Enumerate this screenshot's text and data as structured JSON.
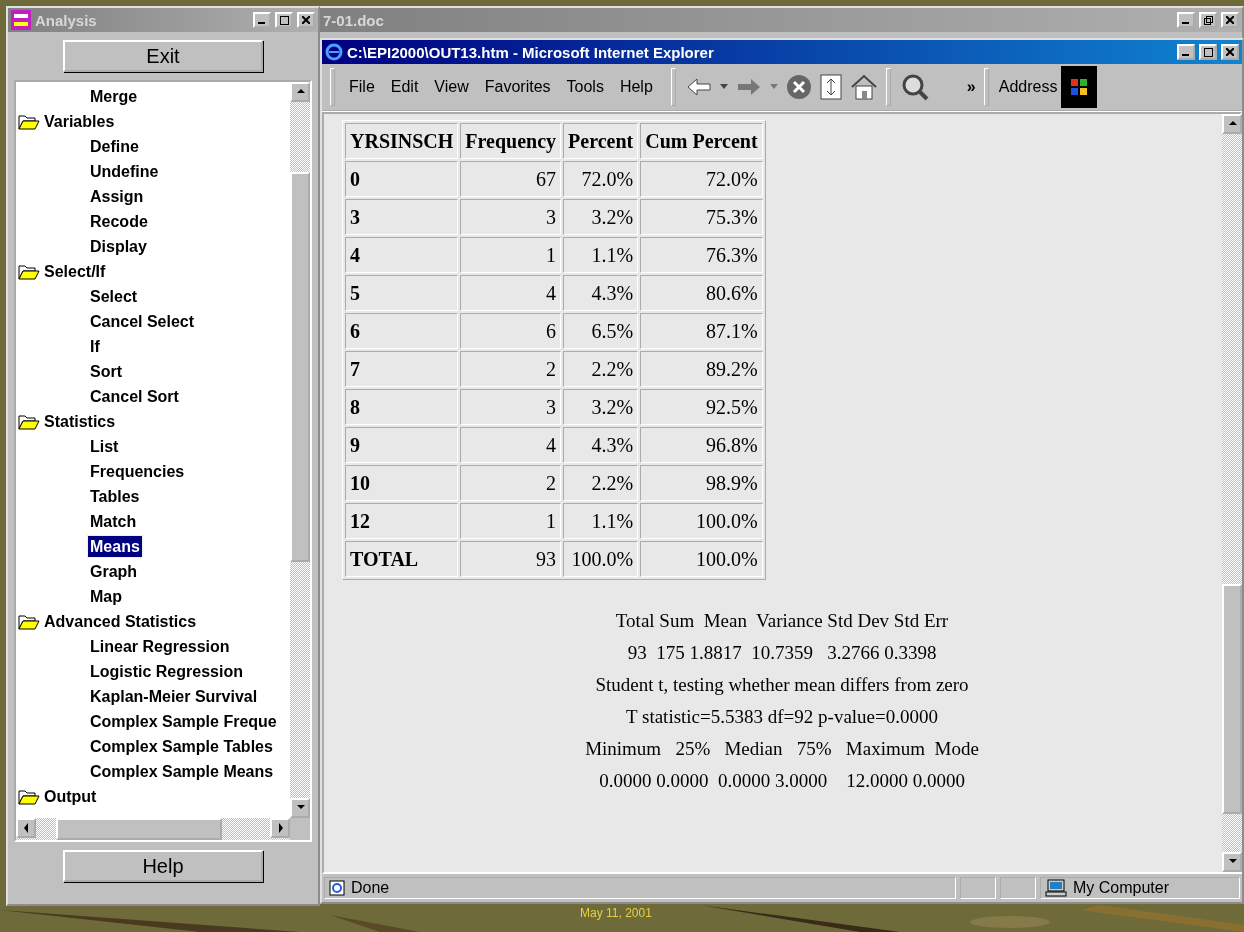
{
  "desktop": {
    "date": "May 11, 2001"
  },
  "back_window": {
    "title": "7-01.doc"
  },
  "analysis_window": {
    "title": "Analysis",
    "exit_button": "Exit",
    "help_button": "Help",
    "tree": [
      {
        "children": [
          {
            "label": "Merge",
            "selected": false
          }
        ]
      },
      {
        "label": "Variables",
        "expanded": true,
        "children": [
          {
            "label": "Define",
            "selected": false
          },
          {
            "label": "Undefine",
            "selected": false
          },
          {
            "label": "Assign",
            "selected": false
          },
          {
            "label": "Recode",
            "selected": false
          },
          {
            "label": "Display",
            "selected": false
          }
        ]
      },
      {
        "label": "Select/If",
        "expanded": true,
        "children": [
          {
            "label": "Select",
            "selected": false
          },
          {
            "label": "Cancel Select",
            "selected": false
          },
          {
            "label": "If",
            "selected": false
          },
          {
            "label": "Sort",
            "selected": false
          },
          {
            "label": "Cancel Sort",
            "selected": false
          }
        ]
      },
      {
        "label": "Statistics",
        "expanded": true,
        "children": [
          {
            "label": "List",
            "selected": false
          },
          {
            "label": "Frequencies",
            "selected": false
          },
          {
            "label": "Tables",
            "selected": false
          },
          {
            "label": "Match",
            "selected": false
          },
          {
            "label": "Means",
            "selected": true
          },
          {
            "label": "Graph",
            "selected": false
          },
          {
            "label": "Map",
            "selected": false
          }
        ]
      },
      {
        "label": "Advanced Statistics",
        "expanded": true,
        "children": [
          {
            "label": "Linear Regression",
            "selected": false
          },
          {
            "label": "Logistic Regression",
            "selected": false
          },
          {
            "label": "Kaplan-Meier Survival",
            "selected": false
          },
          {
            "label": "Complex Sample Freque",
            "selected": false
          },
          {
            "label": "Complex Sample Tables",
            "selected": false
          },
          {
            "label": "Complex Sample Means",
            "selected": false
          }
        ]
      },
      {
        "label": "Output",
        "expanded": true
      }
    ]
  },
  "browser_window": {
    "title": "C:\\EPI2000\\OUT13.htm - Microsoft Internet Explorer",
    "menu": [
      "File",
      "Edit",
      "View",
      "Favorites",
      "Tools",
      "Help"
    ],
    "toolbar_more": "»",
    "address_label": "Address",
    "table": {
      "columns": [
        "YRSINSCH",
        "Frequency",
        "Percent",
        "Cum Percent"
      ],
      "rows": [
        [
          "0",
          "67",
          "72.0%",
          "72.0%"
        ],
        [
          "3",
          "3",
          "3.2%",
          "75.3%"
        ],
        [
          "4",
          "1",
          "1.1%",
          "76.3%"
        ],
        [
          "5",
          "4",
          "4.3%",
          "80.6%"
        ],
        [
          "6",
          "6",
          "6.5%",
          "87.1%"
        ],
        [
          "7",
          "2",
          "2.2%",
          "89.2%"
        ],
        [
          "8",
          "3",
          "3.2%",
          "92.5%"
        ],
        [
          "9",
          "4",
          "4.3%",
          "96.8%"
        ],
        [
          "10",
          "2",
          "2.2%",
          "98.9%"
        ],
        [
          "12",
          "1",
          "1.1%",
          "100.0%"
        ],
        [
          "TOTAL",
          "93",
          "100.0%",
          "100.0%"
        ]
      ]
    },
    "stats_lines": [
      "Total Sum  Mean  Variance Std Dev Std Err",
      "93  175 1.8817  10.7359   3.2766 0.3398",
      "Student t, testing whether mean differs from zero",
      "T statistic=5.5383 df=92 p-value=0.0000",
      "Minimum   25%   Median   75%   Maximum  Mode",
      "0.0000 0.0000  0.0000 3.0000    12.0000 0.0000"
    ],
    "status_text": "Done",
    "zone": "My Computer"
  }
}
